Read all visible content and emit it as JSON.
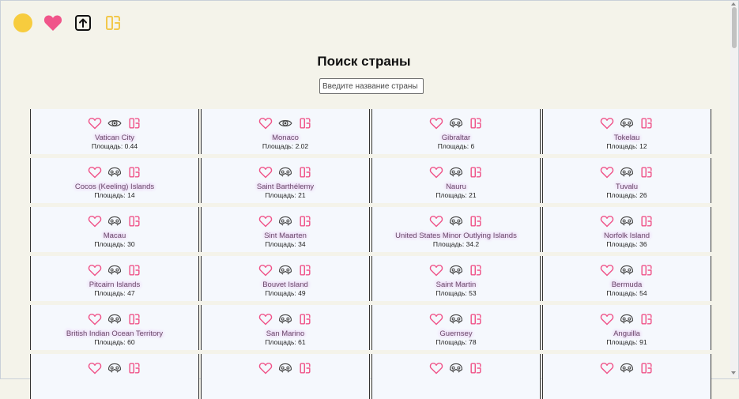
{
  "header": {
    "icons": [
      "sun-icon",
      "heart-icon",
      "upload-icon",
      "compare-icon"
    ]
  },
  "title": "Поиск страны",
  "search": {
    "placeholder": "Введите название страны",
    "value": ""
  },
  "area_label": "Площадь: ",
  "colors": {
    "accent": "#f0558a",
    "background": "#f4f3ea",
    "card": "#f5f8fd",
    "sun": "#f7cc3e",
    "compare_top": "#f2c84b"
  },
  "countries": [
    {
      "name": "Vatican City",
      "area": "0.44",
      "icon": "eye"
    },
    {
      "name": "Monaco",
      "area": "2.02",
      "icon": "eye"
    },
    {
      "name": "Gibraltar",
      "area": "6",
      "icon": "mask"
    },
    {
      "name": "Tokelau",
      "area": "12",
      "icon": "mask"
    },
    {
      "name": "Cocos (Keeling) Islands",
      "area": "14",
      "icon": "mask"
    },
    {
      "name": "Saint Barthélemy",
      "area": "21",
      "icon": "mask"
    },
    {
      "name": "Nauru",
      "area": "21",
      "icon": "mask"
    },
    {
      "name": "Tuvalu",
      "area": "26",
      "icon": "mask"
    },
    {
      "name": "Macau",
      "area": "30",
      "icon": "mask"
    },
    {
      "name": "Sint Maarten",
      "area": "34",
      "icon": "mask"
    },
    {
      "name": "United States Minor Outlying Islands",
      "area": "34.2",
      "icon": "mask"
    },
    {
      "name": "Norfolk Island",
      "area": "36",
      "icon": "mask"
    },
    {
      "name": "Pitcairn Islands",
      "area": "47",
      "icon": "mask"
    },
    {
      "name": "Bouvet Island",
      "area": "49",
      "icon": "mask"
    },
    {
      "name": "Saint Martin",
      "area": "53",
      "icon": "mask"
    },
    {
      "name": "Bermuda",
      "area": "54",
      "icon": "mask"
    },
    {
      "name": "British Indian Ocean Territory",
      "area": "60",
      "icon": "mask"
    },
    {
      "name": "San Marino",
      "area": "61",
      "icon": "mask"
    },
    {
      "name": "Guernsey",
      "area": "78",
      "icon": "mask"
    },
    {
      "name": "Anguilla",
      "area": "91",
      "icon": "mask"
    },
    {
      "name": "",
      "area": "",
      "icon": "mask"
    },
    {
      "name": "",
      "area": "",
      "icon": "mask"
    },
    {
      "name": "",
      "area": "",
      "icon": "mask"
    },
    {
      "name": "",
      "area": "",
      "icon": "mask"
    }
  ]
}
